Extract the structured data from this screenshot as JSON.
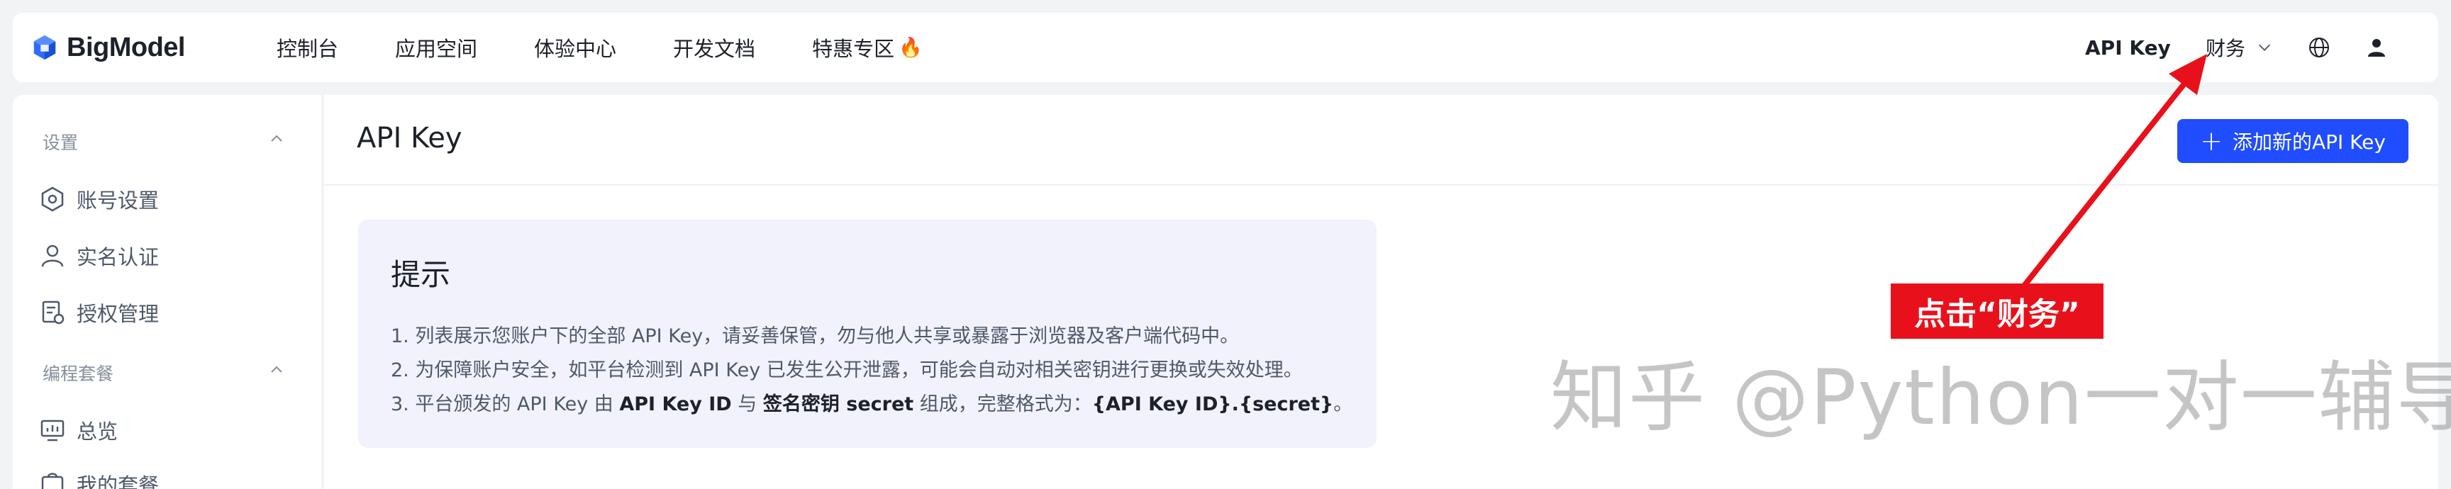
{
  "app": {
    "logo_text": "BigModel"
  },
  "nav": {
    "items": [
      "控制台",
      "应用空间",
      "体验中心",
      "开发文档",
      "特惠专区"
    ],
    "promo_icon": "fire-emoji",
    "right": {
      "api_key": "API Key",
      "finance": "财务",
      "globe_icon": "globe-icon",
      "user_icon": "user-icon"
    }
  },
  "sidebar": {
    "groups": [
      {
        "label": "设置",
        "items": [
          "账号设置",
          "实名认证",
          "授权管理"
        ]
      },
      {
        "label": "编程套餐",
        "items": [
          "总览",
          "我的套餐"
        ]
      }
    ]
  },
  "main": {
    "title": "API Key",
    "add_button": "添加新的API Key",
    "tip": {
      "title": "提示",
      "line1": "1. 列表展示您账户下的全部 API Key，请妥善保管，勿与他人共享或暴露于浏览器及客户端代码中。",
      "line2": "2. 为保障账户安全，如平台检测到 API Key 已发生公开泄露，可能会自动对相关密钥进行更换或失效处理。",
      "line3_pre": "3. 平台颁发的 API Key 由 ",
      "line3_b1": "API Key ID",
      "line3_mid": " 与 ",
      "line3_b2": "签名密钥 secret",
      "line3_post": " 组成，完整格式为：",
      "line3_b3": "{API Key ID}.{secret}",
      "line3_end": "。"
    }
  },
  "annotation": {
    "callout": "点击“财务”",
    "color": "#e8111b"
  },
  "watermark": "知乎 @Python一对一辅导"
}
